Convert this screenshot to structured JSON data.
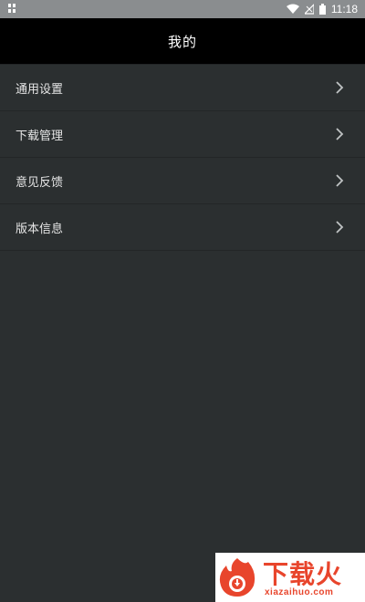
{
  "status_bar": {
    "time": "11:18",
    "icons": [
      "notification-icon",
      "wifi-icon",
      "signal-icon",
      "battery-icon"
    ]
  },
  "header": {
    "title": "我的"
  },
  "menu": {
    "items": [
      {
        "label": "通用设置",
        "icon": "chevron-right-icon"
      },
      {
        "label": "下载管理",
        "icon": "chevron-right-icon"
      },
      {
        "label": "意见反馈",
        "icon": "chevron-right-icon"
      },
      {
        "label": "版本信息",
        "icon": "chevron-right-icon"
      }
    ]
  },
  "watermark": {
    "brand": "下载火",
    "url": "xiazaihuo.com"
  },
  "colors": {
    "status_bar_bg": "#8a8d8f",
    "header_bg": "#000000",
    "content_bg": "#2b2f30",
    "divider": "#232627",
    "text": "#e6e6e6",
    "watermark_accent": "#e8452c"
  }
}
